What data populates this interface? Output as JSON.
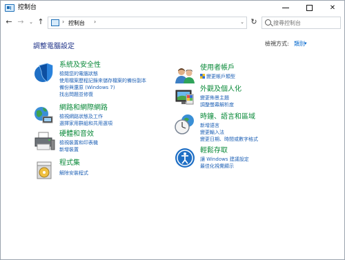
{
  "window": {
    "title": "控制台",
    "controls": {
      "minimize": "minimize",
      "maximize": "maximize",
      "close": "✕"
    }
  },
  "nav": {
    "back": "←",
    "forward": "→",
    "dropdown": "⌄",
    "up": "↑",
    "breadcrumb": "控制台",
    "crumb_separator": "›",
    "refresh": "↻",
    "search_placeholder": "搜尋控制台"
  },
  "main": {
    "title": "調整電腦設定",
    "view_by_label": "檢視方式:",
    "view_by_value": "類別",
    "view_by_arrow": "▾"
  },
  "categories": [
    {
      "title": "系統及安全性",
      "icon": "shield-icon",
      "links": [
        "檢閱您的電腦狀態",
        "使用檔案歷程記錄來儲存檔案的備份副本",
        "備份與還原 (Windows 7)",
        "找出問題並修復"
      ]
    },
    {
      "title": "網路和網際網路",
      "icon": "network-globe-icon",
      "links": [
        "檢視網路狀態及工作",
        "選擇家用群組和共用選項"
      ]
    },
    {
      "title": "硬體和音效",
      "icon": "printer-icon",
      "links": [
        "檢視裝置和印表機",
        "新增裝置"
      ]
    },
    {
      "title": "程式集",
      "icon": "programs-disc-icon",
      "links": [
        "解除安裝程式"
      ]
    },
    {
      "title": "使用者帳戶",
      "icon": "users-icon",
      "links": [
        "變更帳戶類型"
      ]
    },
    {
      "title": "外觀及個人化",
      "icon": "appearance-monitor-icon",
      "links": [
        "變更佈景主題",
        "調整螢幕解析度"
      ]
    },
    {
      "title": "時鐘、語言和區域",
      "icon": "clock-globe-icon",
      "links": [
        "新增語言",
        "變更輸入法",
        "變更日期、時間或數字格式"
      ]
    },
    {
      "title": "輕鬆存取",
      "icon": "ease-of-access-icon",
      "links": [
        "讓 Windows 建議設定",
        "最佳化視覺顯示"
      ]
    }
  ],
  "colors": {
    "category_title": "#0b8a3a",
    "link": "#1c5fb5",
    "page_title": "#1e3287"
  }
}
